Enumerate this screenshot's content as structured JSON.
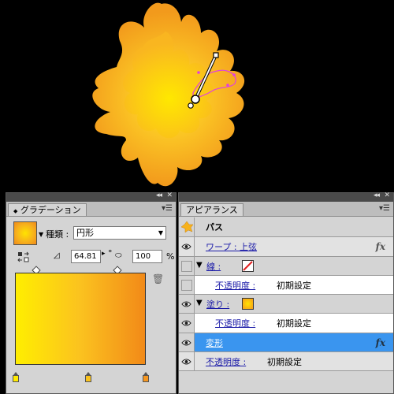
{
  "gradient_panel": {
    "title": "グラデーション",
    "type_label": "種類 :",
    "type_value": "円形",
    "angle_value": "64.81",
    "angle_unit": "°",
    "aspect_value": "100",
    "aspect_unit": "%",
    "stops": [
      {
        "color": "#ffea00"
      },
      {
        "color": "#f9c21e"
      },
      {
        "color": "#f59620"
      }
    ]
  },
  "appearance_panel": {
    "title": "アピアランス",
    "object_label": "パス",
    "warp_label": "ワープ : 上弦",
    "stroke_label": "線 :",
    "opacity_label": "不透明度 :",
    "opacity_value": "初期設定",
    "fill_label": "塗り :",
    "transform_label": "変形",
    "fx_label": "fx"
  },
  "colors": {
    "accent_selection": "#3a95ef",
    "link": "#1a1aa8",
    "flower_center": "#ffe600",
    "flower_outer": "#f4a51c"
  }
}
